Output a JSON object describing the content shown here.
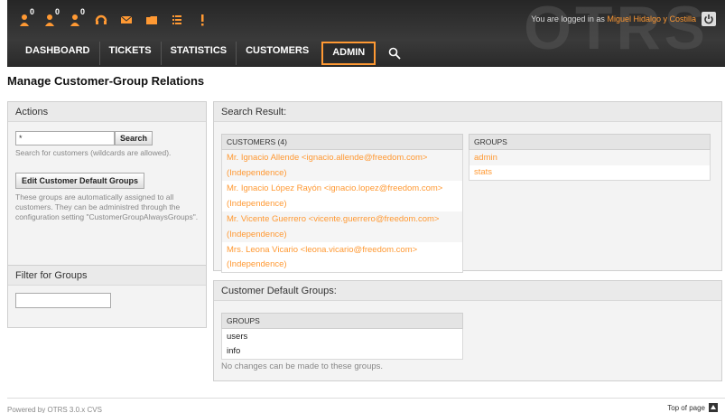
{
  "header": {
    "toolbar": [
      {
        "icon": "locked-tickets-icon",
        "count": "0"
      },
      {
        "icon": "watched-tickets-icon",
        "count": "0"
      },
      {
        "icon": "responsible-tickets-icon",
        "count": "0"
      },
      {
        "icon": "phone-ticket-icon",
        "count": ""
      },
      {
        "icon": "email-ticket-icon",
        "count": ""
      },
      {
        "icon": "folder-icon",
        "count": ""
      },
      {
        "icon": "list-icon",
        "count": ""
      },
      {
        "icon": "escalation-icon",
        "count": ""
      }
    ],
    "login_prefix": "You are logged in as",
    "user_name": "Miguel Hidalgo y Costilla",
    "logo": "OTRS"
  },
  "nav": {
    "items": [
      "DASHBOARD",
      "TICKETS",
      "STATISTICS",
      "CUSTOMERS",
      "ADMIN"
    ],
    "active": "ADMIN"
  },
  "page_title": "Manage Customer-Group Relations",
  "actions": {
    "title": "Actions",
    "search_value": "*",
    "search_button": "Search",
    "search_hint": "Search for customers (wildcards are allowed).",
    "edit_button": "Edit Customer Default Groups",
    "edit_hint": "These groups are automatically assigned to all customers. They can be administred through the configuration setting \"CustomerGroupAlwaysGroups\"."
  },
  "filter": {
    "title": "Filter for Groups",
    "value": ""
  },
  "search_result": {
    "title": "Search Result:",
    "customers_header": "CUSTOMERS (4)",
    "customers": [
      "Mr. Ignacio Allende <ignacio.allende@freedom.com>",
      "(Independence)",
      "Mr. Ignacio López Rayón <ignacio.lopez@freedom.com>",
      "(Independence)",
      "Mr. Vicente Guerrero <vicente.guerrero@freedom.com>",
      "(Independence)",
      "Mrs. Leona Vicario <leona.vicario@freedom.com>",
      "(Independence)"
    ],
    "groups_header": "GROUPS",
    "groups": [
      "admin",
      "stats"
    ]
  },
  "default_groups": {
    "title": "Customer Default Groups:",
    "header": "GROUPS",
    "groups": [
      "users",
      "info"
    ],
    "note": "No changes can be made to these groups."
  },
  "footer": {
    "powered": "Powered by OTRS 3.0.x CVS",
    "top": "Top of page"
  },
  "colors": {
    "accent": "#ff9933",
    "header_bg": "#2e2e2e"
  }
}
